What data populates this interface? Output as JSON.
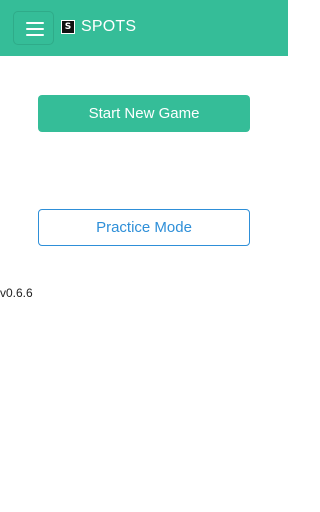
{
  "header": {
    "menu_icon": "hamburger-menu-icon",
    "logo_letter": "S",
    "brand_name": "SPOTS"
  },
  "main": {
    "start_button_label": "Start New Game",
    "practice_button_label": "Practice Mode",
    "version": "v0.6.6"
  },
  "colors": {
    "primary": "#35bd98",
    "practice_accent": "#2e8fd8",
    "background": "#ffffff"
  }
}
